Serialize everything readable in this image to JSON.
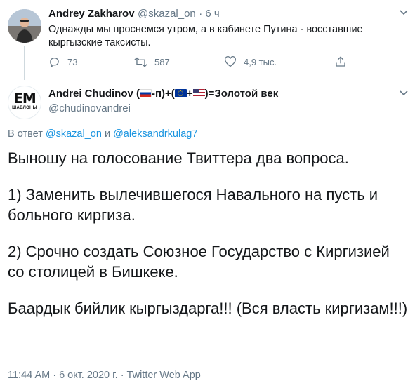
{
  "tweet1": {
    "name": "Andrey Zakharov",
    "handle": "@skazal_on",
    "time": "· 6 ч",
    "text": "Однажды мы проснемся утром, а в кабинете Путина - восставшие кыргызские таксисты.",
    "reply_count": "73",
    "retweet_count": "587",
    "like_count": "4,9 тыс."
  },
  "tweet2": {
    "name_pre": "Andrei Chudinov (",
    "name_part1": "-п)+(",
    "name_part2": "+",
    "name_part3": ")=Золотой век",
    "handle": "@chudinovandrei",
    "avatar_logo": "EM",
    "avatar_sub": "ШАБЛОНЫ",
    "reply_prefix": "В ответ",
    "reply_user1": "@skazal_on",
    "reply_and": "и",
    "reply_user2": "@aleksandrkulag7",
    "paragraphs": [
      "Выношу на голосование Твиттера два вопроса.",
      "1) Заменить вылечившегося Навального на пусть и больного киргиза.",
      "2) Срочно создать Союзное Государство с Киргизией со столицей в Бишкеке.",
      "Баардык бийлик кыргыздарга!!! (Вся власть киргизам!!!)"
    ],
    "timestamp": "11:44 AM · 6 окт. 2020 г. · Twitter Web App"
  },
  "icons": {
    "reply": "reply-icon",
    "retweet": "retweet-icon",
    "like": "heart-icon",
    "share": "share-icon",
    "more": "chevron-down-icon"
  },
  "colors": {
    "link": "#1b95e0",
    "muted": "#657786",
    "text": "#14171a"
  }
}
